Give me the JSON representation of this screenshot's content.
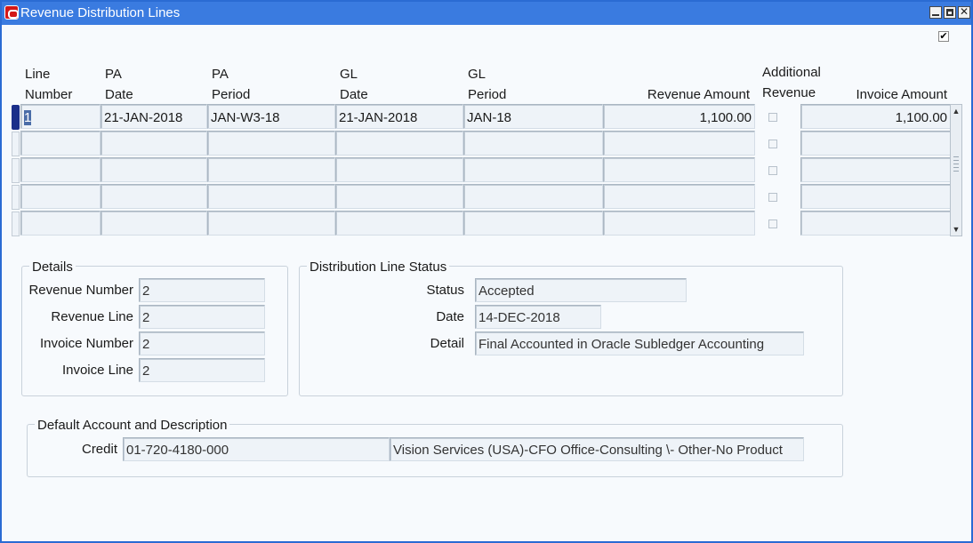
{
  "window": {
    "title": "Revenue Distribution Lines"
  },
  "grid": {
    "headers": {
      "line_number": [
        "Line",
        "Number"
      ],
      "pa_date": [
        "PA",
        "Date"
      ],
      "pa_period": [
        "PA",
        "Period"
      ],
      "gl_date": [
        "GL",
        "Date"
      ],
      "gl_period": [
        "GL",
        "Period"
      ],
      "revenue_amount": "Revenue Amount",
      "additional_revenue": [
        "Additional",
        "Revenue"
      ],
      "invoice_amount": "Invoice Amount"
    },
    "rows": [
      {
        "line_number": "1",
        "pa_date": "21-JAN-2018",
        "pa_period": "JAN-W3-18",
        "gl_date": "21-JAN-2018",
        "gl_period": "JAN-18",
        "revenue_amount": "1,100.00",
        "additional_revenue": false,
        "invoice_amount": "1,100.00"
      },
      {
        "line_number": "",
        "pa_date": "",
        "pa_period": "",
        "gl_date": "",
        "gl_period": "",
        "revenue_amount": "",
        "additional_revenue": false,
        "invoice_amount": ""
      },
      {
        "line_number": "",
        "pa_date": "",
        "pa_period": "",
        "gl_date": "",
        "gl_period": "",
        "revenue_amount": "",
        "additional_revenue": false,
        "invoice_amount": ""
      },
      {
        "line_number": "",
        "pa_date": "",
        "pa_period": "",
        "gl_date": "",
        "gl_period": "",
        "revenue_amount": "",
        "additional_revenue": false,
        "invoice_amount": ""
      },
      {
        "line_number": "",
        "pa_date": "",
        "pa_period": "",
        "gl_date": "",
        "gl_period": "",
        "revenue_amount": "",
        "additional_revenue": false,
        "invoice_amount": ""
      }
    ]
  },
  "details": {
    "title": "Details",
    "revenue_number": {
      "label": "Revenue Number",
      "value": "2"
    },
    "revenue_line": {
      "label": "Revenue Line",
      "value": "2"
    },
    "invoice_number": {
      "label": "Invoice Number",
      "value": "2"
    },
    "invoice_line": {
      "label": "Invoice Line",
      "value": "2"
    }
  },
  "status_section": {
    "title": "Distribution Line Status",
    "status": {
      "label": "Status",
      "value": "Accepted"
    },
    "date": {
      "label": "Date",
      "value": "14-DEC-2018"
    },
    "detail": {
      "label": "Detail",
      "value": "Final Accounted in Oracle Subledger Accounting"
    }
  },
  "account": {
    "title": "Default Account and Description",
    "credit_label": "Credit",
    "credit_account": "01-720-4180-000",
    "credit_description": "Vision Services (USA)-CFO Office-Consulting \\- Other-No Product"
  },
  "colors": {
    "titlebar": "#3a7be0",
    "row_indicator": "#1b2f8a"
  }
}
